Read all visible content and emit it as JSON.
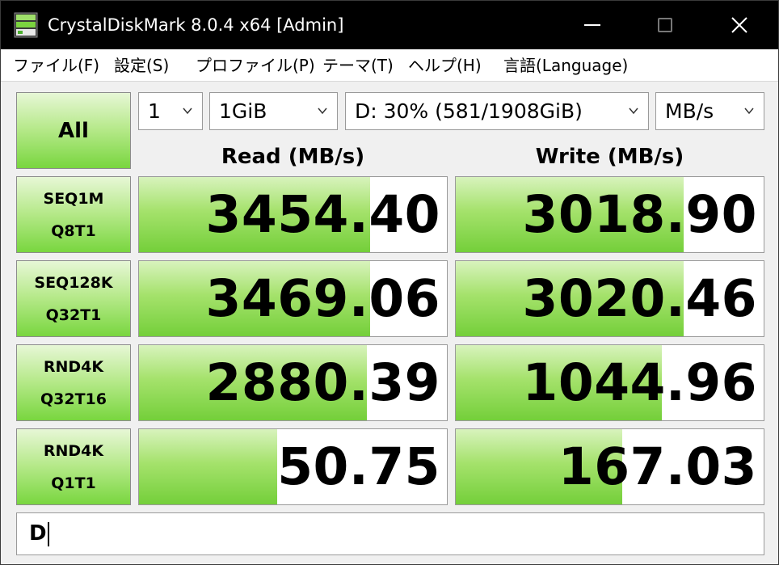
{
  "window": {
    "title": "CrystalDiskMark 8.0.4 x64 [Admin]"
  },
  "menu": [
    "ファイル(F)",
    "設定(S)",
    "プロファイル(P)",
    "テーマ(T)",
    "ヘルプ(H)",
    "言語(Language)"
  ],
  "controls": {
    "all_label": "All",
    "count": "1",
    "size": "1GiB",
    "drive": "D: 30% (581/1908GiB)",
    "unit": "MB/s"
  },
  "headers": {
    "read": "Read (MB/s)",
    "write": "Write (MB/s)"
  },
  "rows": [
    {
      "label_line1": "SEQ1M",
      "label_line2": "Q8T1",
      "read": "3454.40",
      "write": "3018.90",
      "read_fill": 0.75,
      "write_fill": 0.74
    },
    {
      "label_line1": "SEQ128K",
      "label_line2": "Q32T1",
      "read": "3469.06",
      "write": "3020.46",
      "read_fill": 0.75,
      "write_fill": 0.74
    },
    {
      "label_line1": "RND4K",
      "label_line2": "Q32T16",
      "read": "2880.39",
      "write": "1044.96",
      "read_fill": 0.74,
      "write_fill": 0.67
    },
    {
      "label_line1": "RND4K",
      "label_line2": "Q1T1",
      "read": "50.75",
      "write": "167.03",
      "read_fill": 0.45,
      "write_fill": 0.54
    }
  ],
  "comment": "D",
  "colors": {
    "accent_green": "#79d63f",
    "titlebar": "#000000"
  }
}
